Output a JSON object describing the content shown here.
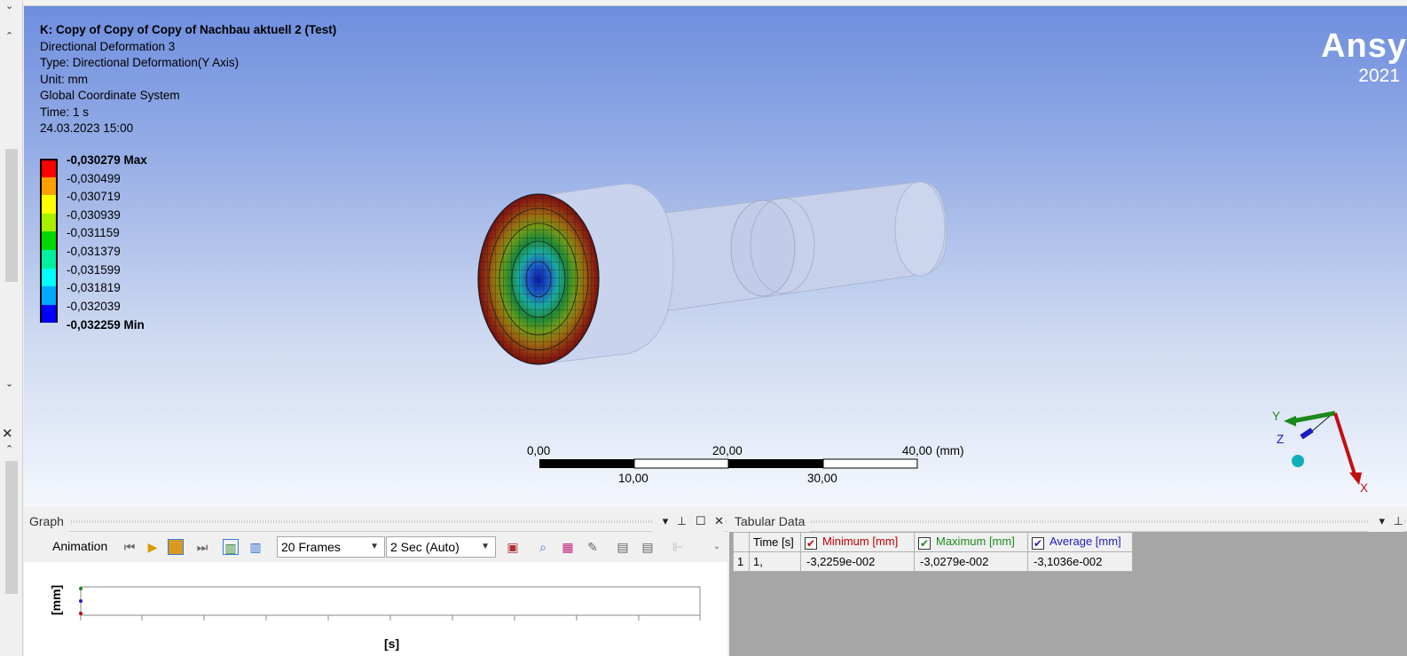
{
  "viewport": {
    "info": {
      "title": "K: Copy of Copy of Copy of Nachbau aktuell 2 (Test)",
      "result_name": "Directional Deformation 3",
      "type": "Type: Directional Deformation(Y Axis)",
      "unit": "Unit: mm",
      "coord": "Global Coordinate System",
      "time": "Time: 1 s",
      "date": "24.03.2023 15:00"
    },
    "legend": {
      "max_label": "-0,030279 Max",
      "labels": [
        "-0,030499",
        "-0,030719",
        "-0,030939",
        "-0,031159",
        "-0,031379",
        "-0,031599",
        "-0,031819",
        "-0,032039"
      ],
      "min_label": "-0,032259 Min",
      "colors": [
        "#ff0000",
        "#ff9f00",
        "#ffff00",
        "#a8f000",
        "#00d800",
        "#00f0a0",
        "#00ffff",
        "#00a8ff",
        "#0000ff"
      ]
    },
    "brand": {
      "name": "Ansy",
      "year": "2021"
    },
    "scale": {
      "top_labels": [
        "0,00",
        "20,00",
        "40,00"
      ],
      "unit": "(mm)",
      "bottom_labels": [
        "10,00",
        "30,00"
      ]
    },
    "triad": {
      "x": "X",
      "y": "Y",
      "z": "Z"
    }
  },
  "graph": {
    "title": "Graph",
    "animation_label": "Animation",
    "frames": "20 Frames",
    "duration": "2 Sec (Auto)",
    "ylabel": "[mm]",
    "xlabel": "[s]"
  },
  "tabular": {
    "title": "Tabular Data",
    "headers": {
      "time": "Time [s]",
      "min": "Minimum [mm]",
      "max": "Maximum [mm]",
      "avg": "Average [mm]"
    },
    "header_colors": {
      "min": "#c00000",
      "max": "#1a8a1a",
      "avg": "#2020c0"
    },
    "rows": [
      {
        "index": "1",
        "time": "1,",
        "min": "-3,2259e-002",
        "max": "-3,0279e-002",
        "avg": "-3,1036e-002"
      }
    ]
  }
}
